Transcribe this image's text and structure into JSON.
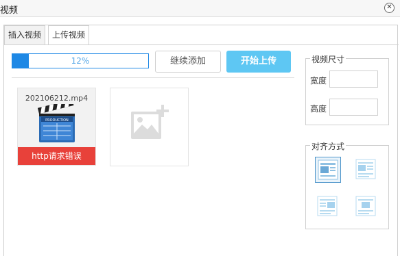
{
  "dialog": {
    "title": "视频",
    "close_glyph": "✕"
  },
  "tabs": [
    {
      "label": "插入视频"
    },
    {
      "label": "上传视频"
    }
  ],
  "upload": {
    "progress_text": "12%",
    "progress_value": 0.12,
    "continue_label": "继续添加",
    "start_label": "开始上传",
    "file": {
      "name": "202106212.mp4",
      "error": "http请求错误",
      "icon": "video-clapperboard-icon"
    },
    "add_icon": "add-image-icon"
  },
  "size": {
    "legend": "视频尺寸",
    "width_label": "宽度",
    "height_label": "高度",
    "width_value": "",
    "height_value": ""
  },
  "align": {
    "legend": "对齐方式",
    "options": [
      {
        "icon": "align-none-icon",
        "active": true
      },
      {
        "icon": "align-left-icon",
        "active": false
      },
      {
        "icon": "align-right-icon",
        "active": false
      },
      {
        "icon": "align-center-icon",
        "active": false
      }
    ]
  },
  "colors": {
    "progress": "#1e88e5",
    "start_button": "#5ec7f3",
    "error": "#e8413a"
  }
}
